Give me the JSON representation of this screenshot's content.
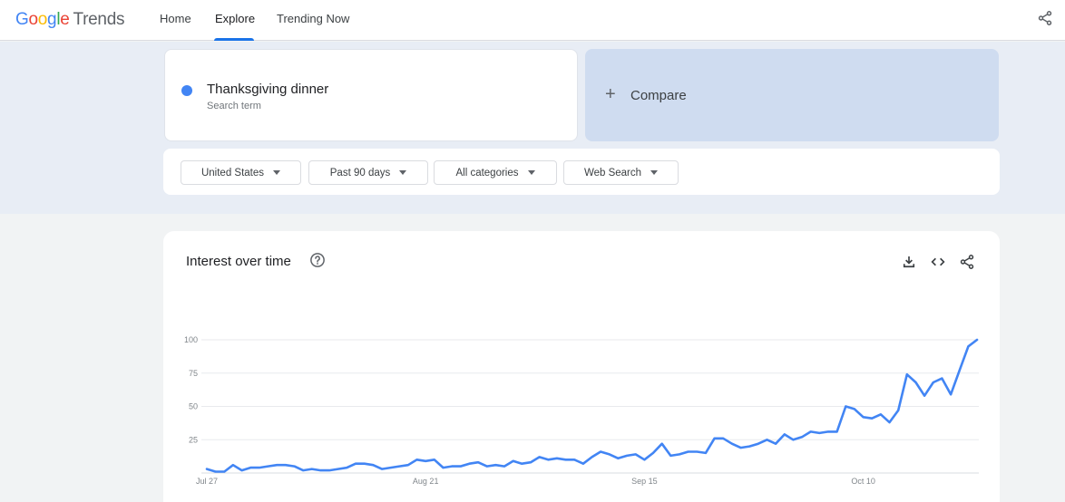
{
  "header": {
    "logo": {
      "google": "Google",
      "trends": "Trends"
    },
    "tabs": [
      {
        "label": "Home"
      },
      {
        "label": "Explore",
        "active": true
      },
      {
        "label": "Trending Now"
      }
    ],
    "share_icon": "share-icon"
  },
  "search": {
    "term": {
      "name": "Thanksgiving dinner",
      "type": "Search term",
      "color": "#4285f4"
    },
    "compare_label": "Compare"
  },
  "filters": [
    {
      "label": "United States"
    },
    {
      "label": "Past 90 days"
    },
    {
      "label": "All categories"
    },
    {
      "label": "Web Search"
    }
  ],
  "chart_card": {
    "title": "Interest over time",
    "icons": [
      "help-icon",
      "download-icon",
      "embed-icon",
      "share-icon"
    ]
  },
  "chart_data": {
    "type": "line",
    "title": "Interest over time",
    "xlabel": "",
    "ylabel": "",
    "ylim": [
      0,
      100
    ],
    "yticks": [
      "100",
      "75",
      "50",
      "25"
    ],
    "xticks": [
      {
        "label": "Jul 27",
        "index": 0
      },
      {
        "label": "Aug 21",
        "index": 25
      },
      {
        "label": "Sep 15",
        "index": 50
      },
      {
        "label": "Oct 10",
        "index": 75
      }
    ],
    "grid": true,
    "series": [
      {
        "color": "#4285f4",
        "values": [
          3,
          1,
          1,
          6,
          2,
          4,
          4,
          5,
          6,
          6,
          5,
          2,
          3,
          2,
          2,
          3,
          4,
          7,
          7,
          6,
          3,
          4,
          5,
          6,
          10,
          9,
          10,
          4,
          5,
          5,
          7,
          8,
          5,
          6,
          5,
          9,
          7,
          8,
          12,
          10,
          11,
          10,
          10,
          7,
          12,
          16,
          14,
          11,
          13,
          14,
          10,
          15,
          22,
          13,
          14,
          16,
          16,
          15,
          26,
          26,
          22,
          19,
          20,
          22,
          25,
          22,
          29,
          25,
          27,
          31,
          30,
          31,
          31,
          50,
          48,
          42,
          41,
          44,
          38,
          47,
          74,
          68,
          58,
          68,
          71,
          59,
          77,
          95,
          100
        ]
      }
    ]
  }
}
